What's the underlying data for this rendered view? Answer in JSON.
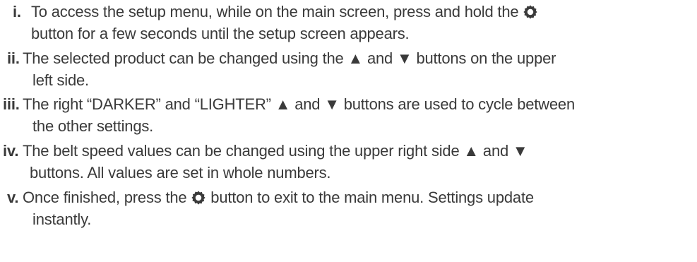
{
  "instructions": [
    {
      "numeral": "i.",
      "line1_pre": "To access the setup menu, while on the main screen, press and hold the",
      "line1_icon": "gear-icon",
      "line2": "button for a few seconds until the setup screen appears."
    },
    {
      "numeral": "ii.",
      "line1": "The selected product can be changed using the ▲ and ▼ buttons on the upper",
      "line2": "left side."
    },
    {
      "numeral": "iii.",
      "line1": "The right “DARKER” and “LIGHTER” ▲ and ▼ buttons are used to cycle between",
      "line2": "the other settings."
    },
    {
      "numeral": "iv.",
      "line1": "The belt speed values can be changed using the upper right side ▲ and ▼",
      "line2": "buttons. All values are set in whole numbers."
    },
    {
      "numeral": "v.",
      "line1_pre": "Once finished, press the",
      "line1_icon": "gear-icon",
      "line1_post": "button to exit to the main menu. Settings update",
      "line2": "instantly."
    }
  ]
}
